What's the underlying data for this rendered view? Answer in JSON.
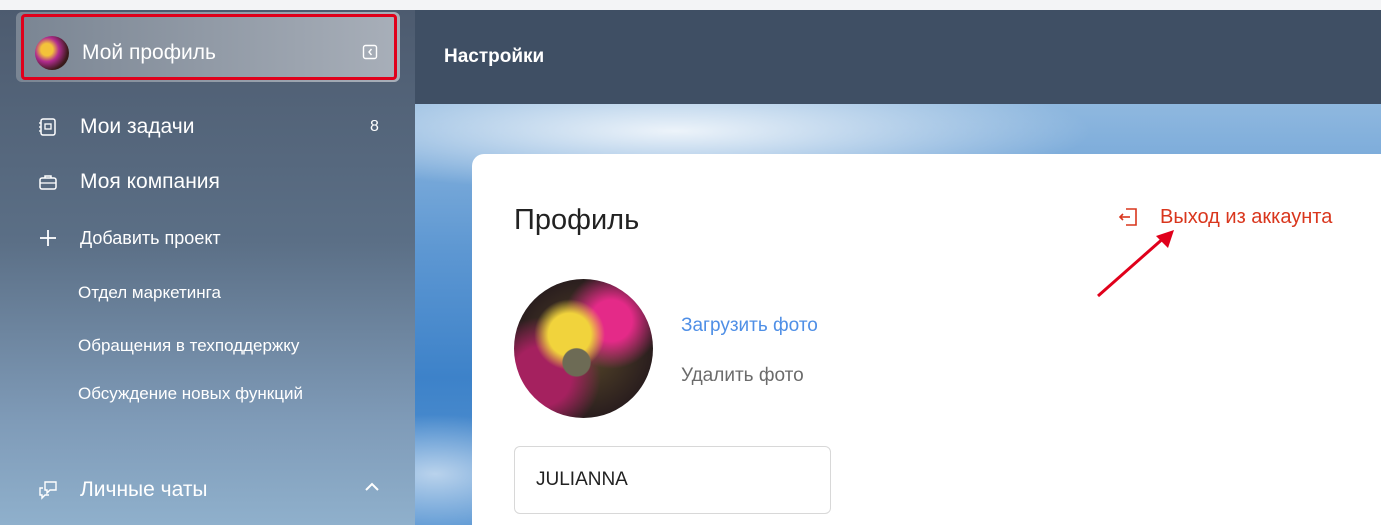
{
  "sidebar": {
    "profile_label": "Мой профиль",
    "items": [
      {
        "label": "Мои задачи",
        "badge": "8",
        "icon": "tasks-icon"
      },
      {
        "label": "Моя компания",
        "icon": "briefcase-icon"
      },
      {
        "label": "Добавить проект",
        "icon": "plus-icon"
      }
    ],
    "projects": [
      "Отдел маркетинга",
      "Обращения в техподдержку",
      "Обсуждение новых функций"
    ],
    "chats_label": "Личные чаты"
  },
  "header": {
    "title": "Настройки"
  },
  "profile": {
    "title": "Профиль",
    "logout_label": "Выход из аккаунта",
    "upload_photo": "Загрузить фото",
    "delete_photo": "Удалить фото",
    "name_value": "JULIANNA"
  },
  "colors": {
    "highlight": "#e0001b",
    "logout": "#d9361d",
    "link": "#4f8fe6",
    "topbar": "#3f4f64"
  }
}
